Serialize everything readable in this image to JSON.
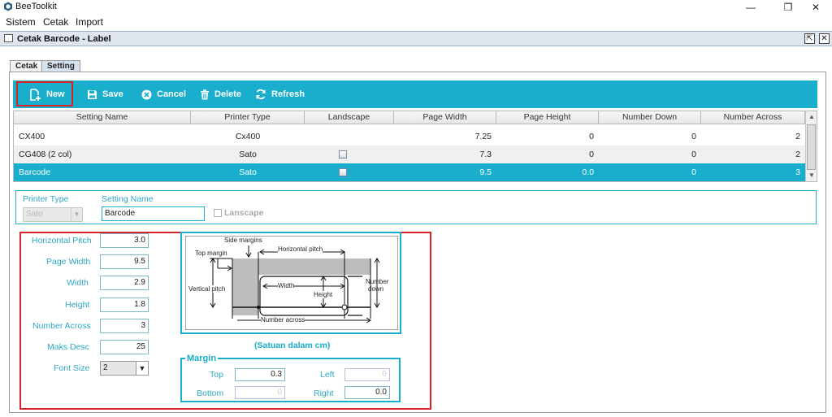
{
  "app": {
    "title": "BeeToolkit"
  },
  "window_controls": {
    "minimize": "—",
    "restore": "❐",
    "close": "✕"
  },
  "menu": [
    "Sistem",
    "Cetak",
    "Import"
  ],
  "frame": {
    "title": "Cetak Barcode - Label"
  },
  "tabs": [
    "Cetak",
    "Setting"
  ],
  "toolbar": {
    "new": "New",
    "save": "Save",
    "cancel": "Cancel",
    "delete": "Delete",
    "refresh": "Refresh"
  },
  "table": {
    "columns": [
      "Setting Name",
      "Printer Type",
      "Landscape",
      "Page Width",
      "Page Height",
      "Number Down",
      "Number Across"
    ],
    "rows": [
      {
        "name": "CX400",
        "printer": "Cx400",
        "landscape": false,
        "page_width": "7.25",
        "page_height": "0",
        "number_down": "0",
        "number_across": "2"
      },
      {
        "name": "CG408 (2 col)",
        "printer": "Sato",
        "landscape": false,
        "page_width": "7.3",
        "page_height": "0",
        "number_down": "0",
        "number_across": "2"
      },
      {
        "name": "Barcode",
        "printer": "Sato",
        "landscape": false,
        "page_width": "9.5",
        "page_height": "0.0",
        "number_down": "0",
        "number_across": "3"
      }
    ]
  },
  "form": {
    "printer_type_label": "Printer Type",
    "printer_type_value": "Sato",
    "setting_name_label": "Setting Name",
    "setting_name_value": "Barcode",
    "lanscape_label": "Lanscape"
  },
  "dimensions": {
    "horizontal_pitch_label": "Horizontal Pitch",
    "horizontal_pitch": "3.0",
    "page_width_label": "Page Width",
    "page_width": "9.5",
    "width_label": "Width",
    "width": "2.9",
    "height_label": "Height",
    "height": "1.8",
    "number_across_label": "Number Across",
    "number_across": "3",
    "maks_desc_label": "Maks Desc",
    "maks_desc": "25",
    "font_size_label": "Font Size",
    "font_size": "2"
  },
  "diagram": {
    "side_margins": "Side margins",
    "horizontal_pitch": "Horizontal pitch",
    "top_margin": "Top margin",
    "vertical_pitch": "Vertical pitch",
    "width": "Width",
    "height": "Height",
    "number_down": "Number down",
    "number_down_l1": "Number",
    "number_down_l2": "down",
    "number_across": "Number across",
    "caption": "(Satuan dalam cm)"
  },
  "margin": {
    "title": "Margin",
    "top_label": "Top",
    "top": "0.3",
    "left_label": "Left",
    "left": "0",
    "bottom_label": "Bottom",
    "bottom": "0",
    "right_label": "Right",
    "right": "0.0"
  },
  "colors": {
    "accent": "#19aecb",
    "highlight_row": "#19aecb",
    "callout": "#d9232a",
    "label": "#2fa7c4"
  }
}
